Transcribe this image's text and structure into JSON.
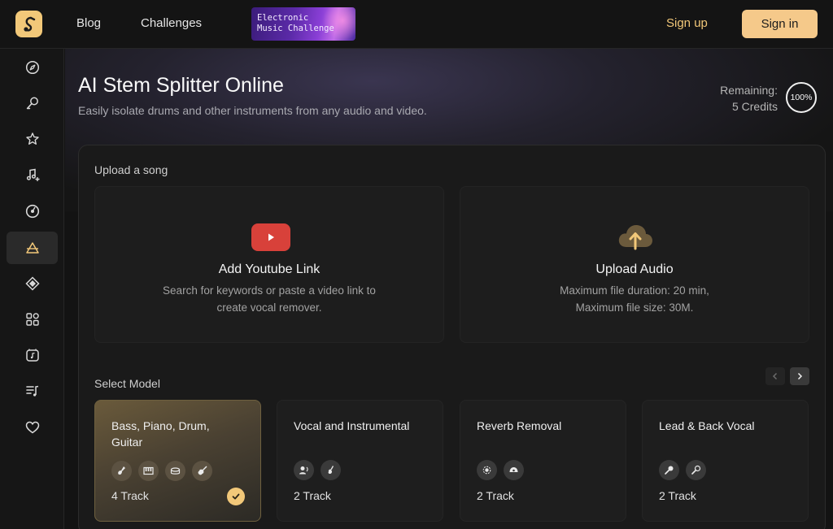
{
  "nav": {
    "blog": "Blog",
    "challenges": "Challenges",
    "promo": "Electronic\nMusic Challenge",
    "sign_up": "Sign up",
    "sign_in": "Sign in",
    "accent": "#f2c879"
  },
  "sidebar": {
    "items": [
      {
        "icon": "compass-icon"
      },
      {
        "icon": "microphone-icon"
      },
      {
        "icon": "star-icon"
      },
      {
        "icon": "music-note-plus-icon"
      },
      {
        "icon": "vinyl-record-icon"
      },
      {
        "icon": "stem-splitter-icon",
        "active": true
      },
      {
        "icon": "diamond-icon"
      },
      {
        "icon": "apps-grid-icon"
      },
      {
        "icon": "music-box-icon"
      },
      {
        "icon": "playlist-icon"
      },
      {
        "icon": "heart-icon"
      }
    ]
  },
  "header": {
    "title": "AI Stem Splitter Online",
    "subtitle": "Easily isolate drums and other instruments from any audio and video.",
    "remaining_label": "Remaining:",
    "credits": "5 Credits",
    "credits_percent": "100%"
  },
  "upload": {
    "section_label": "Upload a song",
    "youtube": {
      "title": "Add Youtube Link",
      "description": "Search for keywords or paste a video link to create vocal remover."
    },
    "audio": {
      "title": "Upload Audio",
      "description_line1": "Maximum file duration: 20 min,",
      "description_line2": "Maximum file size: 30M."
    }
  },
  "models": {
    "section_label": "Select Model",
    "items": [
      {
        "name": "Bass, Piano, Drum, Guitar",
        "tracks": "4 Track",
        "selected": true,
        "icons": [
          "bass-icon",
          "piano-icon",
          "drum-icon",
          "guitar-icon"
        ]
      },
      {
        "name": "Vocal and Instrumental",
        "tracks": "2 Track",
        "selected": false,
        "icons": [
          "vocal-icon",
          "instrument-icon"
        ]
      },
      {
        "name": "Reverb Removal",
        "tracks": "2 Track",
        "selected": false,
        "icons": [
          "reverb-icon",
          "dry-icon"
        ]
      },
      {
        "name": "Lead & Back Vocal",
        "tracks": "2 Track",
        "selected": false,
        "icons": [
          "lead-mic-icon",
          "back-mic-icon"
        ]
      }
    ]
  }
}
